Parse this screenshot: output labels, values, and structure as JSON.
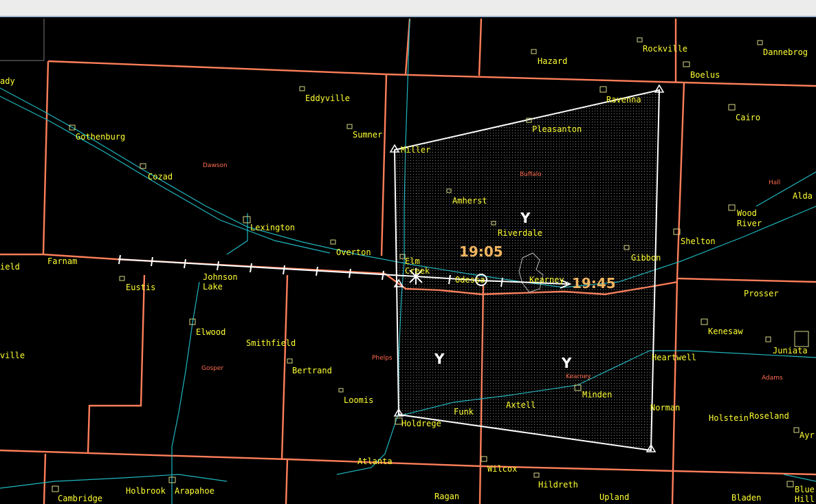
{
  "colors": {
    "background": "#000000",
    "county_border": "#ff7f5a",
    "highway": "#1fb7c0",
    "town_label": "#ffff33",
    "county_label": "#ff6a50",
    "warning_polygon": "#ffffff",
    "time_label": "#f0b460"
  },
  "towns": [
    {
      "id": "ady",
      "label": "ady"
    },
    {
      "id": "gothenburg",
      "label": "Gothenburg"
    },
    {
      "id": "cozad",
      "label": "Cozad"
    },
    {
      "id": "eddyville",
      "label": "Eddyville"
    },
    {
      "id": "sumner",
      "label": "Sumner"
    },
    {
      "id": "miller",
      "label": "Miller"
    },
    {
      "id": "pleasanton",
      "label": "Pleasanton"
    },
    {
      "id": "ravenna",
      "label": "Ravenna"
    },
    {
      "id": "hazard",
      "label": "Hazard"
    },
    {
      "id": "rockville",
      "label": "Rockville"
    },
    {
      "id": "boelus",
      "label": "Boelus"
    },
    {
      "id": "dannebrog",
      "label": "Dannebrog"
    },
    {
      "id": "cairo",
      "label": "Cairo"
    },
    {
      "id": "alda",
      "label": "Alda"
    },
    {
      "id": "wood",
      "label": "Wood"
    },
    {
      "id": "river",
      "label": "River"
    },
    {
      "id": "shelton",
      "label": "Shelton"
    },
    {
      "id": "gibbon",
      "label": "Gibbon"
    },
    {
      "id": "amherst",
      "label": "Amherst"
    },
    {
      "id": "riverdale",
      "label": "Riverdale"
    },
    {
      "id": "lexington",
      "label": "Lexington"
    },
    {
      "id": "overton",
      "label": "Overton"
    },
    {
      "id": "elm",
      "label": "Elm"
    },
    {
      "id": "creek",
      "label": "Creek"
    },
    {
      "id": "odessa",
      "label": "Odessa"
    },
    {
      "id": "kearney",
      "label": "Kearney"
    },
    {
      "id": "farnam",
      "label": "Farnam"
    },
    {
      "id": "ield",
      "label": "ield"
    },
    {
      "id": "eustis",
      "label": "Eustis"
    },
    {
      "id": "johnson",
      "label": "Johnson"
    },
    {
      "id": "lake",
      "label": "Lake"
    },
    {
      "id": "prosser",
      "label": "Prosser"
    },
    {
      "id": "kenesaw",
      "label": "Kenesaw"
    },
    {
      "id": "juniata",
      "label": "Juniata"
    },
    {
      "id": "heartwell",
      "label": "Heartwell"
    },
    {
      "id": "elwood",
      "label": "Elwood"
    },
    {
      "id": "smithfield",
      "label": "Smithfield"
    },
    {
      "id": "bertrand",
      "label": "Bertrand"
    },
    {
      "id": "ville",
      "label": "ville"
    },
    {
      "id": "loomis",
      "label": "Loomis"
    },
    {
      "id": "funk",
      "label": "Funk"
    },
    {
      "id": "axtell",
      "label": "Axtell"
    },
    {
      "id": "minden",
      "label": "Minden"
    },
    {
      "id": "norman",
      "label": "Norman"
    },
    {
      "id": "holstein",
      "label": "Holstein"
    },
    {
      "id": "roseland",
      "label": "Roseland"
    },
    {
      "id": "holdrege",
      "label": "Holdrege"
    },
    {
      "id": "ayr",
      "label": "Ayr"
    },
    {
      "id": "atlanta",
      "label": "Atlanta"
    },
    {
      "id": "wilcox",
      "label": "Wilcox"
    },
    {
      "id": "hildreth",
      "label": "Hildreth"
    },
    {
      "id": "upland",
      "label": "Upland"
    },
    {
      "id": "ragan",
      "label": "Ragan"
    },
    {
      "id": "bladen",
      "label": "Bladen"
    },
    {
      "id": "blue",
      "label": "Blue"
    },
    {
      "id": "hill",
      "label": "Hill"
    },
    {
      "id": "cambridge",
      "label": "Cambridge"
    },
    {
      "id": "holbrook",
      "label": "Holbrook"
    },
    {
      "id": "arapahoe",
      "label": "Arapahoe"
    }
  ],
  "counties": [
    {
      "id": "dawson",
      "label": "Dawson"
    },
    {
      "id": "buffalo",
      "label": "Buffalo"
    },
    {
      "id": "hall",
      "label": "Hall"
    },
    {
      "id": "phelps",
      "label": "Phelps"
    },
    {
      "id": "gosper",
      "label": "Gosper"
    },
    {
      "id": "kearney-county",
      "label": "Kearney"
    },
    {
      "id": "adams",
      "label": "Adams"
    }
  ],
  "storm_track": {
    "start_time": "19:05",
    "end_time": "19:45"
  },
  "warning_polygon": {
    "county_letters": [
      "Y",
      "Y",
      "Y"
    ]
  }
}
